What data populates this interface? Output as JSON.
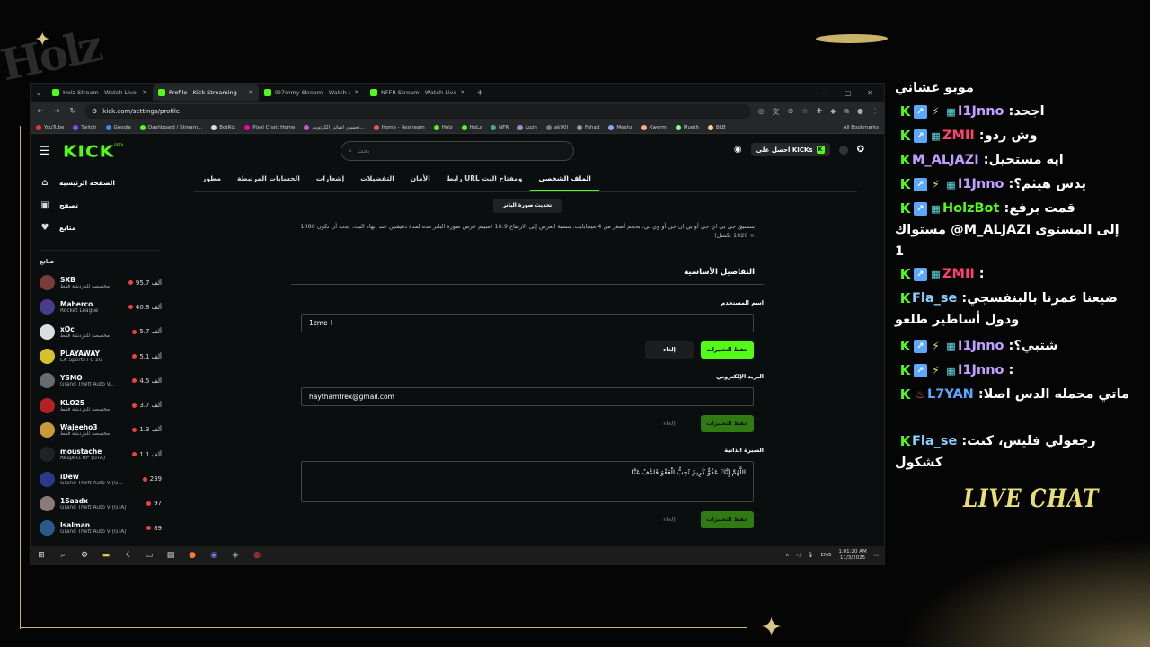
{
  "stream": {
    "logo_text": "Holz",
    "live_chat_label": "LIVE CHAT",
    "accent_color": "#e9e074"
  },
  "browser": {
    "tabs": [
      {
        "title": "Holz Stream - Watch Live on Ki",
        "active": false
      },
      {
        "title": "Profile - Kick Streaming",
        "active": true
      },
      {
        "title": "ID7mmy Stream - Watch Live o",
        "active": false
      },
      {
        "title": "NFFR Stream - Watch Live on K",
        "active": false
      }
    ],
    "url": "kick.com/settings/profile",
    "bookmarks": [
      "YouTube",
      "Twitch",
      "Google",
      "Dashboard / Stream...",
      "BotRix",
      "Pixel Chat: Home",
      "تحسين انماتي الكرتوني...",
      "Home - Restream",
      "Holz",
      "HoLz",
      "NFR",
      "Lozh",
      "ak90l",
      "Fahad",
      "Meshz",
      "Kwerm",
      "Mueth",
      "BLB"
    ],
    "all_bookmarks": "All Bookmarks"
  },
  "kick": {
    "brand_color": "#53fc18",
    "logo": "KICK",
    "beta": "BETA",
    "search_placeholder": "بحث",
    "get_kicks": "احصل على KICKs",
    "nav": [
      {
        "label": "الصفحة الرئيسية",
        "icon": "home-icon"
      },
      {
        "label": "تصفح",
        "icon": "browse-icon"
      },
      {
        "label": "متابع",
        "icon": "heart-icon"
      }
    ],
    "following_title": "متابع",
    "channels": [
      {
        "name": "SXB",
        "game": "مخصصة للدردشة فقط",
        "viewers": "95.7 ألف",
        "color": "#7a3b3b"
      },
      {
        "name": "Maherco",
        "game": "Rocket League",
        "viewers": "40.8 ألف",
        "color": "#4a3c8a"
      },
      {
        "name": "xQc",
        "game": "مخصصة للدردشة فقط",
        "viewers": "5.7 ألف",
        "color": "#dddddd"
      },
      {
        "name": "PLAYAWAY",
        "game": "EA Sports FC 26",
        "viewers": "5.1 ألف",
        "color": "#d6c22a"
      },
      {
        "name": "YSMO",
        "game": "Grand Theft Auto V...",
        "viewers": "4.5 ألف",
        "color": "#6a6a6a"
      },
      {
        "name": "KLO25",
        "game": "مخصصة للدردشة فقط",
        "viewers": "3.7 ألف",
        "color": "#b52020"
      },
      {
        "name": "Wajeeho3",
        "game": "مخصصة للدردشة فقط",
        "viewers": "1.3 ألف",
        "color": "#c89a3a"
      },
      {
        "name": "moustache",
        "game": "Respect RP (GTA)",
        "viewers": "1.1 ألف",
        "color": "#222222"
      },
      {
        "name": "iDew",
        "game": "Grand Theft Auto V (G...",
        "viewers": "239",
        "color": "#2a3a8a"
      },
      {
        "name": "1Saadx",
        "game": "Grand Theft Auto V (GTA)",
        "viewers": "97",
        "color": "#8a7a7a"
      },
      {
        "name": "Isalman",
        "game": "Grand Theft Auto V (GTA)",
        "viewers": "89",
        "color": "#2a5a8a"
      }
    ],
    "settings_tabs": [
      {
        "label": "الملف الشخصي",
        "active": true
      },
      {
        "label": "رابط URL ومفتاح البث",
        "active": false
      },
      {
        "label": "الأمان",
        "active": false
      },
      {
        "label": "التفضيلات",
        "active": false
      },
      {
        "label": "إشعارات",
        "active": false
      },
      {
        "label": "الحسابات المرتبطة",
        "active": false
      },
      {
        "label": "مطور",
        "active": false
      }
    ],
    "upload_banner_label": "تحديث صورة البانر",
    "banner_note": "بتنسيق جي بي اي جي أو بي ان جي أو وي بي، بحجم أصغر من 4 ميجابايت. بنسبة العرض إلى الارتفاع 16:9 (سيتم عرض صورة البانر هذه لمدة دقيقتين عند إنهاء البث. يجب أن تكون 1080 × 1920 بكسل)",
    "section_title": "التفاصيل الأساسية",
    "username_label": "اسم المستخدم",
    "username_value": "1zme",
    "email_label": "البريد الإلكتروني",
    "email_value": "haythamtrex@gmail.com",
    "bio_label": "السيرة الذاتية",
    "bio_value": "اللَّهُمَّ إِنَّكَ عَفُوٌّ كَرِيمٌ تُحِبُّ الْعَفْوَ فَاعْفُ عَنَّا",
    "save_label": "حفظ التغييرات",
    "cancel_label": "إلغاء"
  },
  "taskbar": {
    "lang": "ENG",
    "time": "1:01:20 AM",
    "date": "11/3/2025"
  },
  "chat": {
    "messages": [
      {
        "user": "",
        "text": "موبو عشاني",
        "badges": [],
        "color": "#ffffff"
      },
      {
        "user": "I1Jnno",
        "text": "اجحد",
        "badges": [
          "kick",
          "blue",
          "bolt",
          "sub"
        ],
        "color": "#c0a0ff"
      },
      {
        "user": "ZMII",
        "text": "وش ردو",
        "badges": [
          "kick",
          "blue",
          "sub"
        ],
        "color": "#ff4070"
      },
      {
        "user": "M_ALJAZI",
        "text": "ايه مستحيل",
        "badges": [
          "kick"
        ],
        "color": "#c0a0ff"
      },
      {
        "user": "I1Jnno",
        "text": "يدس هيثم؟",
        "badges": [
          "kick",
          "blue",
          "bolt",
          "sub"
        ],
        "color": "#c0a0ff"
      },
      {
        "user": "HolzBot",
        "text": "قمت برفع مستواك @M_ALJAZI إلى المستوى 1",
        "badges": [
          "kick",
          "blue",
          "sub"
        ],
        "color": "#53fc18"
      },
      {
        "user": "ZMII",
        "text": "",
        "badges": [
          "kick",
          "blue",
          "sub"
        ],
        "color": "#ff4070"
      },
      {
        "user": "Fla_se",
        "text": "ضيعنا عمرنا بالبنفسجي ودول أساطير طلعو",
        "badges": [
          "kick"
        ],
        "color": "#8ad0ff"
      },
      {
        "user": "I1Jnno",
        "text": "شتبي؟",
        "badges": [
          "kick",
          "blue",
          "bolt",
          "sub"
        ],
        "color": "#c0a0ff"
      },
      {
        "user": "I1Jnno",
        "text": "",
        "badges": [
          "kick",
          "blue",
          "bolt",
          "sub"
        ],
        "color": "#c0a0ff"
      },
      {
        "user": "L7YAN",
        "text": "ماتي محمله الدس اصلا",
        "badges": [
          "kick",
          "fire"
        ],
        "color": "#5aa9ff"
      },
      {
        "user": "Fla_se",
        "text": "رجعولي فليس، كنت كشكول",
        "badges": [
          "kick"
        ],
        "color": "#8ad0ff"
      }
    ]
  }
}
